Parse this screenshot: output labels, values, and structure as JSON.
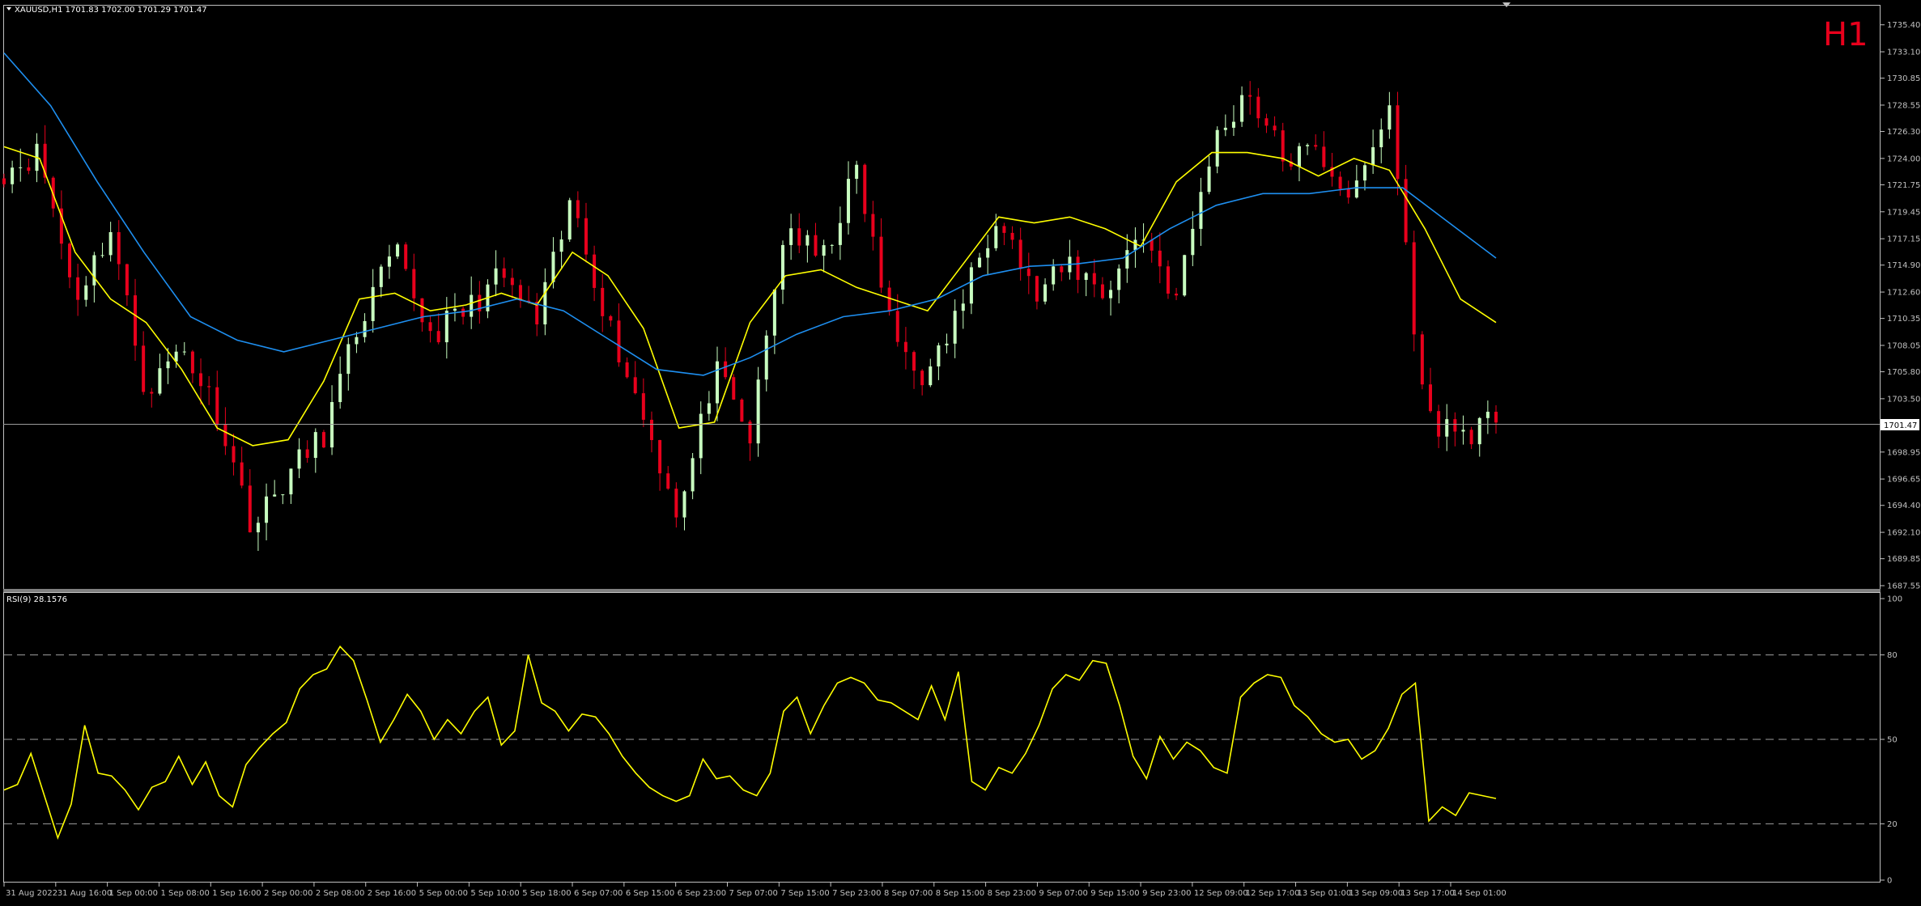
{
  "symbol_header": "XAUUSD,H1  1701.83 1702.00 1701.29 1701.47",
  "timeframe_label": "H1",
  "current_price_label": "1701.47",
  "rsi_header": "RSI(9) 28.1576",
  "colors": {
    "background": "#000000",
    "bull": "#c8ffc0",
    "bear": "#e8001c",
    "ma_fast": "#ffff00",
    "ma_slow": "#1e8ff0",
    "rsi": "#ffff00",
    "axis": "#c0c0c0",
    "timeframe": "#e8001c"
  },
  "chart_data": [
    {
      "type": "candlestick",
      "ylim": [
        1687.55,
        1736.0
      ],
      "y_ticks": [
        "1735.40",
        "1733.10",
        "1730.85",
        "1728.55",
        "1726.30",
        "1724.00",
        "1721.75",
        "1719.45",
        "1717.15",
        "1714.90",
        "1712.60",
        "1710.35",
        "1708.05",
        "1705.80",
        "1703.50",
        "1698.95",
        "1696.65",
        "1694.40",
        "1692.10",
        "1689.85",
        "1687.55"
      ],
      "x_ticks": [
        "31 Aug 2022",
        "31 Aug 16:00",
        "1 Sep 00:00",
        "1 Sep 08:00",
        "1 Sep 16:00",
        "2 Sep 00:00",
        "2 Sep 08:00",
        "2 Sep 16:00",
        "5 Sep 00:00",
        "5 Sep 10:00",
        "5 Sep 18:00",
        "6 Sep 07:00",
        "6 Sep 15:00",
        "6 Sep 23:00",
        "7 Sep 07:00",
        "7 Sep 15:00",
        "7 Sep 23:00",
        "8 Sep 07:00",
        "8 Sep 15:00",
        "8 Sep 23:00",
        "9 Sep 07:00",
        "9 Sep 15:00",
        "9 Sep 23:00",
        "12 Sep 09:00",
        "12 Sep 17:00",
        "13 Sep 01:00",
        "13 Sep 09:00",
        "13 Sep 17:00",
        "14 Sep 01:00"
      ],
      "price_anchors": [
        1723,
        1724.5,
        1712,
        1718,
        1704,
        1708,
        1702.5,
        1692.5,
        1697,
        1700.5,
        1710,
        1716,
        1709,
        1711,
        1714,
        1710,
        1720.5,
        1710,
        1702,
        1693.5,
        1706,
        1700,
        1718.5,
        1715,
        1723,
        1709,
        1705,
        1712,
        1720,
        1712,
        1715,
        1712.5,
        1718,
        1712,
        1725,
        1730,
        1724,
        1724.5,
        1720.5,
        1728.5,
        1702,
        1700.5,
        1701.47
      ],
      "series": [
        {
          "name": "",
          "values": [
            1725,
            1724,
            1716,
            1712,
            1710,
            1706,
            1701,
            1699.5,
            1700,
            1705,
            1712,
            1712.5,
            1711,
            1711.5,
            1712.5,
            1711.5,
            1716,
            1714,
            1709.5,
            1701,
            1701.5,
            1710,
            1714,
            1714.5,
            1713,
            1712,
            1711,
            1715,
            1719,
            1718.5,
            1719,
            1718,
            1716.5,
            1722,
            1724.5,
            1724.5,
            1724,
            1722.5,
            1724,
            1723,
            1718,
            1712,
            1710
          ]
        },
        {
          "name": "",
          "values": [
            1733,
            1728.5,
            1722,
            1716,
            1710.5,
            1708.5,
            1707.5,
            1708.5,
            1709.5,
            1710.5,
            1711,
            1712,
            1711,
            1708.5,
            1706,
            1705.5,
            1707,
            1709,
            1710.5,
            1711,
            1712,
            1714,
            1714.8,
            1715,
            1715.5,
            1718,
            1720,
            1721,
            1721,
            1721.5,
            1721.5,
            1718.5,
            1715.5
          ]
        }
      ]
    },
    {
      "type": "line",
      "title": "RSI(9) 28.1576",
      "ylim": [
        0,
        100
      ],
      "y_ticks": [
        "100",
        "80",
        "50",
        "20",
        "0"
      ],
      "levels": [
        80,
        50,
        20
      ],
      "series": [
        {
          "name": "",
          "values": [
            32,
            34,
            45,
            30,
            15,
            27,
            55,
            38,
            37,
            32,
            25,
            33,
            35,
            44,
            34,
            42,
            30,
            26,
            41,
            47,
            52,
            56,
            68,
            73,
            75,
            83,
            78,
            64,
            49,
            57,
            66,
            60,
            50,
            57,
            52,
            60,
            65,
            48,
            53,
            80,
            63,
            60,
            53,
            59,
            58,
            52,
            44,
            38,
            33,
            30,
            28,
            30,
            43,
            36,
            37,
            32,
            30,
            38,
            60,
            65,
            52,
            62,
            70,
            72,
            70,
            64,
            63,
            60,
            57,
            69,
            57,
            74,
            35,
            32,
            40,
            38,
            45,
            55,
            68,
            73,
            71,
            78,
            77,
            62,
            44,
            36,
            51,
            43,
            49,
            46,
            40,
            38,
            65,
            70,
            73,
            72,
            62,
            58,
            52,
            49,
            50,
            43,
            46,
            54,
            66,
            70,
            21,
            26,
            23,
            31,
            30,
            29
          ]
        }
      ]
    }
  ]
}
